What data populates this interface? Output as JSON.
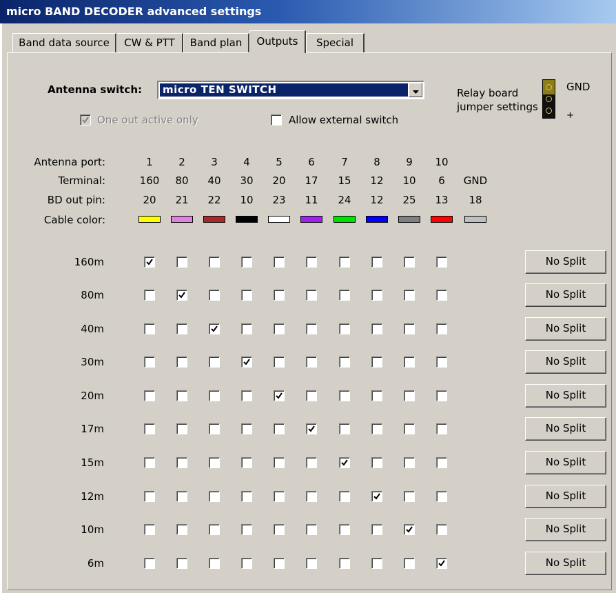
{
  "window": {
    "title": "micro BAND DECODER advanced settings"
  },
  "tabs": [
    {
      "label": "Band data source",
      "active": false
    },
    {
      "label": "CW & PTT",
      "active": false
    },
    {
      "label": "Band plan",
      "active": false
    },
    {
      "label": "Outputs",
      "active": true
    },
    {
      "label": "Special",
      "active": false
    }
  ],
  "antenna_switch": {
    "label": "Antenna switch:",
    "value": "micro TEN SWITCH"
  },
  "options": {
    "one_out_active_only": {
      "label": "One out active only",
      "checked": true,
      "disabled": true
    },
    "allow_external_switch": {
      "label": "Allow external switch",
      "checked": false
    }
  },
  "relay_board": {
    "label_line1": "Relay board",
    "label_line2": "jumper settings",
    "gnd_label": "GND",
    "plus_label": "+"
  },
  "header_labels": {
    "antenna_port": "Antenna port:",
    "terminal": "Terminal:",
    "bd_out_pin": "BD out pin:",
    "cable_color": "Cable color:"
  },
  "ports": [
    "1",
    "2",
    "3",
    "4",
    "5",
    "6",
    "7",
    "8",
    "9",
    "10",
    ""
  ],
  "terminals": [
    "160",
    "80",
    "40",
    "30",
    "20",
    "17",
    "15",
    "12",
    "10",
    "6",
    "GND"
  ],
  "bd_out_pins": [
    "20",
    "21",
    "22",
    "10",
    "23",
    "11",
    "24",
    "12",
    "25",
    "13",
    "18"
  ],
  "cable_colors": [
    "#ffff00",
    "#e080e0",
    "#a52a2a",
    "#000000",
    "#ffffff",
    "#a020f0",
    "#00e000",
    "#0000ff",
    "#808080",
    "#ff0000",
    "#c0c0c0"
  ],
  "bands": [
    {
      "label": "160m",
      "checked": [
        1,
        0,
        0,
        0,
        0,
        0,
        0,
        0,
        0,
        0
      ],
      "button": "No Split"
    },
    {
      "label": "80m",
      "checked": [
        0,
        1,
        0,
        0,
        0,
        0,
        0,
        0,
        0,
        0
      ],
      "button": "No Split"
    },
    {
      "label": "40m",
      "checked": [
        0,
        0,
        1,
        0,
        0,
        0,
        0,
        0,
        0,
        0
      ],
      "button": "No Split"
    },
    {
      "label": "30m",
      "checked": [
        0,
        0,
        0,
        1,
        0,
        0,
        0,
        0,
        0,
        0
      ],
      "button": "No Split"
    },
    {
      "label": "20m",
      "checked": [
        0,
        0,
        0,
        0,
        1,
        0,
        0,
        0,
        0,
        0
      ],
      "button": "No Split"
    },
    {
      "label": "17m",
      "checked": [
        0,
        0,
        0,
        0,
        0,
        1,
        0,
        0,
        0,
        0
      ],
      "button": "No Split"
    },
    {
      "label": "15m",
      "checked": [
        0,
        0,
        0,
        0,
        0,
        0,
        1,
        0,
        0,
        0
      ],
      "button": "No Split"
    },
    {
      "label": "12m",
      "checked": [
        0,
        0,
        0,
        0,
        0,
        0,
        0,
        1,
        0,
        0
      ],
      "button": "No Split"
    },
    {
      "label": "10m",
      "checked": [
        0,
        0,
        0,
        0,
        0,
        0,
        0,
        0,
        1,
        0
      ],
      "button": "No Split"
    },
    {
      "label": "6m",
      "checked": [
        0,
        0,
        0,
        0,
        0,
        0,
        0,
        0,
        0,
        1
      ],
      "button": "No Split"
    }
  ]
}
